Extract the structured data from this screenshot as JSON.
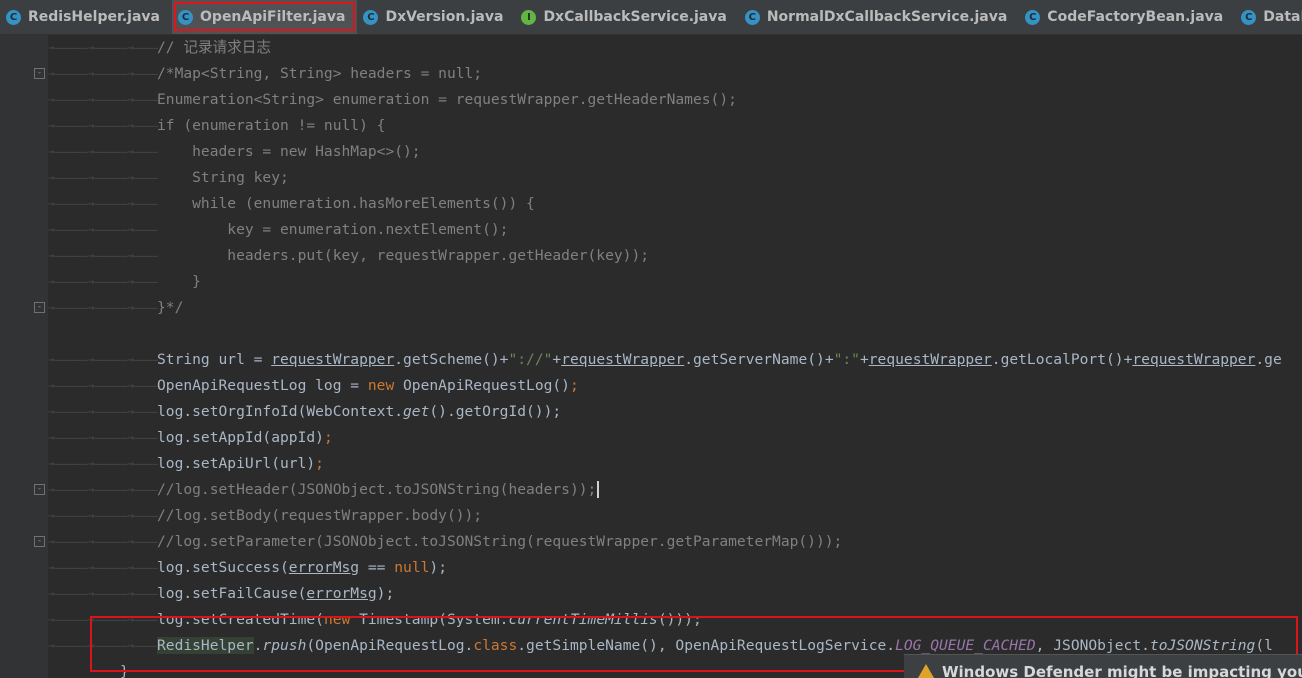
{
  "tabs": [
    {
      "label": "RedisHelper.java",
      "icon": "class-icon",
      "letter": "C",
      "active": false
    },
    {
      "label": "OpenApiFilter.java",
      "icon": "class-icon",
      "letter": "C",
      "active": true
    },
    {
      "label": "DxVersion.java",
      "icon": "class-icon",
      "letter": "C",
      "active": false
    },
    {
      "label": "DxCallbackService.java",
      "icon": "interface-icon",
      "letter": "I",
      "active": false
    },
    {
      "label": "NormalDxCallbackService.java",
      "icon": "class-icon",
      "letter": "C",
      "active": false
    },
    {
      "label": "CodeFactoryBean.java",
      "icon": "class-icon",
      "letter": "C",
      "active": false
    },
    {
      "label": "DataRep",
      "icon": "class-icon",
      "letter": "C",
      "active": false
    }
  ],
  "code": {
    "l1": "// 记录请求日志",
    "l2": "/*Map<String, String> headers = null;",
    "l3": "Enumeration<String> enumeration = requestWrapper.getHeaderNames();",
    "l4": "if (enumeration != null) {",
    "l5": "    headers = new HashMap<>();",
    "l6": "    String key;",
    "l7": "    while (enumeration.hasMoreElements()) {",
    "l8": "        key = enumeration.nextElement();",
    "l9": "        headers.put(key, requestWrapper.getHeader(key));",
    "l10": "    }",
    "l11": "}*/",
    "l13a": "String url = ",
    "l13b": "requestWrapper",
    "l13c": ".getScheme()+",
    "l13d": "\"://\"",
    "l13e": "+",
    "l13f": "requestWrapper",
    "l13g": ".getServerName()+",
    "l13h": "\":\"",
    "l13i": "+",
    "l13j": "requestWrapper",
    "l13k": ".getLocalPort()+",
    "l13l": "requestWrapper",
    "l13m": ".ge",
    "l14a": "OpenApiRequestLog log = ",
    "l14b": "new",
    "l14c": " OpenApiRequestLog()",
    "l14d": ";",
    "l15a": "log.setOrgInfoId(WebContext.",
    "l15b": "get",
    "l15c": "().getOrgId());",
    "l16a": "log.setAppId(appId)",
    "l16b": ";",
    "l17a": "log.setApiUrl(url)",
    "l17b": ";",
    "l18": "//log.setHeader(JSONObject.toJSONString(headers));",
    "l19": "//log.setBody(requestWrapper.body());",
    "l20": "//log.setParameter(JSONObject.toJSONString(requestWrapper.getParameterMap()));",
    "l21a": "log.setSuccess(",
    "l21b": "errorMsg",
    "l21c": " == ",
    "l21d": "null",
    "l21e": ");",
    "l22a": "log.setFailCause(",
    "l22b": "errorMsg",
    "l22c": ");",
    "l23a": "log.setCreatedTime(",
    "l23b": "new",
    "l23c": " Timestamp(System.",
    "l23d": "currentTimeMillis",
    "l23e": "()));",
    "l24a": "RedisHelper",
    "l24b": ".",
    "l24c": "rpush",
    "l24d": "(OpenApiRequestLog.",
    "l24e": "class",
    "l24f": ".getSimpleName(), OpenApiRequestLogService.",
    "l24g": "LOG_QUEUE_CACHED",
    "l24h": ", JSONObject.",
    "l24i": "toJSONString",
    "l24j": "(l",
    "l25": "}"
  },
  "notification": {
    "text": "Windows Defender might be impacting your",
    "icon": "warning-icon"
  },
  "colors": {
    "keyword": "#cc7832",
    "string": "#6a8759",
    "comment": "#808080",
    "field": "#9876aa",
    "text": "#a9b7c6",
    "background": "#2b2b2b",
    "highlight_border": "#d7151b"
  }
}
